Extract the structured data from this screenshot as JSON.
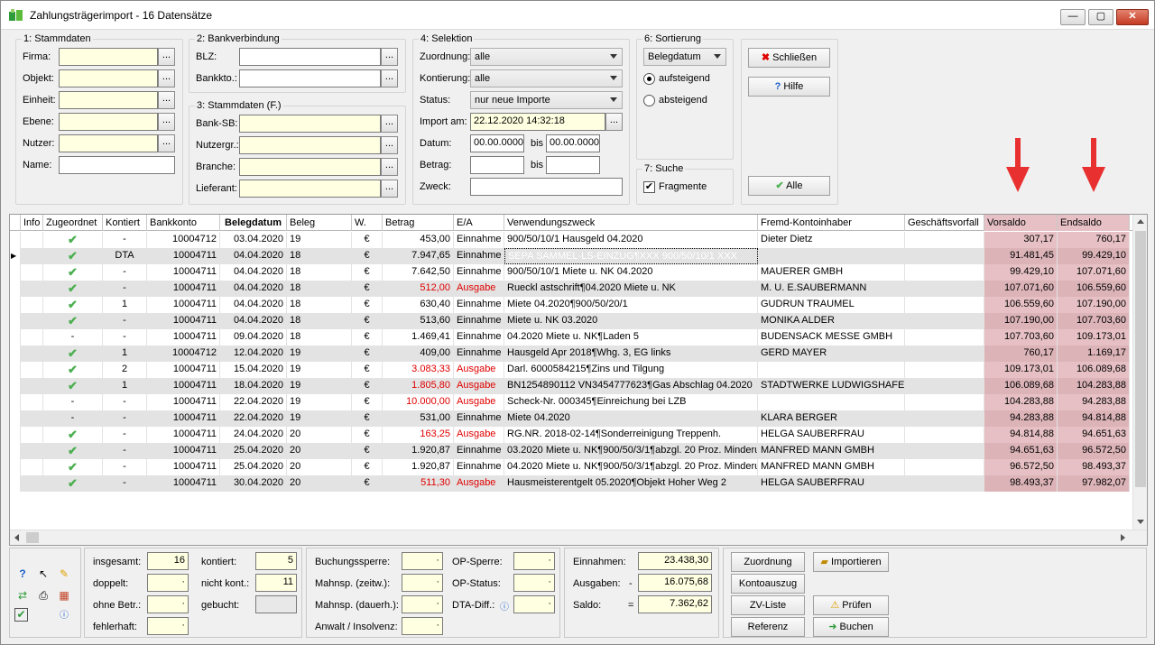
{
  "window": {
    "title": "Zahlungsträgerimport - 16 Datensätze",
    "min": "—",
    "max": "▢",
    "close": "✕"
  },
  "stamm": {
    "title": "1: Stammdaten",
    "fields": [
      {
        "label": "Firma:",
        "value": ""
      },
      {
        "label": "Objekt:",
        "value": ""
      },
      {
        "label": "Einheit:",
        "value": ""
      },
      {
        "label": "Ebene:",
        "value": ""
      },
      {
        "label": "Nutzer:",
        "value": ""
      },
      {
        "label": "Name:",
        "value": ""
      }
    ]
  },
  "bank": {
    "title": "2: Bankverbindung",
    "fields": [
      {
        "label": "BLZ:",
        "value": ""
      },
      {
        "label": "Bankkto.:",
        "value": ""
      }
    ]
  },
  "stammf": {
    "title": "3: Stammdaten (F.)",
    "fields": [
      {
        "label": "Bank-SB:",
        "value": ""
      },
      {
        "label": "Nutzergr.:",
        "value": ""
      },
      {
        "label": "Branche:",
        "value": ""
      },
      {
        "label": "Lieferant:",
        "value": ""
      }
    ]
  },
  "selektion": {
    "title": "4: Selektion",
    "zuordnung_label": "Zuordnung:",
    "zuordnung": "alle",
    "kontierung_label": "Kontierung:",
    "kontierung": "alle",
    "status_label": "Status:",
    "status": "nur neue Importe",
    "import_label": "Import am:",
    "import_value": "22.12.2020 14:32:18",
    "datum_label": "Datum:",
    "datum_from": "00.00.0000",
    "bis": "bis",
    "datum_to": "00.00.0000",
    "betrag_label": "Betrag:",
    "zweck_label": "Zweck:"
  },
  "sort": {
    "title": "6: Sortierung",
    "field": "Belegdatum",
    "asc": "aufsteigend",
    "desc": "absteigend"
  },
  "suche": {
    "title": "7: Suche",
    "fragmente": "Fragmente"
  },
  "buttons": {
    "schliessen": "Schließen",
    "hilfe": "Hilfe",
    "alle": "Alle"
  },
  "columns": [
    "",
    "Info",
    "Zugeordnet",
    "Kontiert",
    "Bankkonto",
    "Belegdatum",
    "Beleg",
    "W.",
    "Betrag",
    "E/A",
    "Verwendungszweck",
    "Fremd-Kontoinhaber",
    "Geschäftsvorfall",
    "Vorsaldo",
    "Endsaldo"
  ],
  "rows": [
    {
      "zug": "✔",
      "kont": "-",
      "konto": "10004712",
      "datum": "03.04.2020",
      "beleg": "19",
      "w": "€",
      "betrag": "453,00",
      "ea": "Einnahme",
      "zweck": "900/50/10/1 Hausgeld 04.2020",
      "fremd": "Dieter Dietz",
      "gv": "",
      "vor": "307,17",
      "end": "760,17"
    },
    {
      "zug": "✔",
      "kont": "DTA",
      "konto": "10004711",
      "datum": "04.04.2020",
      "beleg": "18",
      "w": "€",
      "betrag": "7.947,65",
      "ea": "Einnahme",
      "zweck": "SEPA SAMMEL-LS-EINZUG¶XXX 900/50/10/1 XXX",
      "fremd": "",
      "gv": "",
      "vor": "91.481,45",
      "end": "99.429,10"
    },
    {
      "zug": "✔",
      "kont": "-",
      "konto": "10004711",
      "datum": "04.04.2020",
      "beleg": "18",
      "w": "€",
      "betrag": "7.642,50",
      "ea": "Einnahme",
      "zweck": "900/50/10/1 Miete u. NK 04.2020",
      "fremd": "MAUERER GMBH",
      "gv": "",
      "vor": "99.429,10",
      "end": "107.071,60"
    },
    {
      "zug": "✔",
      "kont": "-",
      "konto": "10004711",
      "datum": "04.04.2020",
      "beleg": "18",
      "w": "€",
      "betrag": "512,00",
      "ea": "Ausgabe",
      "zweck": "Rueckl astschrift¶04.2020 Miete u. NK",
      "fremd": "M. U. E.SAUBERMANN",
      "gv": "",
      "vor": "107.071,60",
      "end": "106.559,60"
    },
    {
      "zug": "✔",
      "kont": "1",
      "konto": "10004711",
      "datum": "04.04.2020",
      "beleg": "18",
      "w": "€",
      "betrag": "630,40",
      "ea": "Einnahme",
      "zweck": "Miete 04.2020¶900/50/20/1",
      "fremd": "GUDRUN TRAUMEL",
      "gv": "",
      "vor": "106.559,60",
      "end": "107.190,00"
    },
    {
      "zug": "✔",
      "kont": "-",
      "konto": "10004711",
      "datum": "04.04.2020",
      "beleg": "18",
      "w": "€",
      "betrag": "513,60",
      "ea": "Einnahme",
      "zweck": "Miete u. NK 03.2020",
      "fremd": "MONIKA ALDER",
      "gv": "",
      "vor": "107.190,00",
      "end": "107.703,60"
    },
    {
      "zug": "-",
      "kont": "-",
      "konto": "10004711",
      "datum": "09.04.2020",
      "beleg": "18",
      "w": "€",
      "betrag": "1.469,41",
      "ea": "Einnahme",
      "zweck": "04.2020 Miete u. NK¶Laden 5",
      "fremd": "BUDENSACK MESSE GMBH",
      "gv": "",
      "vor": "107.703,60",
      "end": "109.173,01"
    },
    {
      "zug": "✔",
      "kont": "1",
      "konto": "10004712",
      "datum": "12.04.2020",
      "beleg": "19",
      "w": "€",
      "betrag": "409,00",
      "ea": "Einnahme",
      "zweck": "Hausgeld Apr 2018¶Whg. 3, EG links",
      "fremd": "GERD MAYER",
      "gv": "",
      "vor": "760,17",
      "end": "1.169,17"
    },
    {
      "zug": "✔",
      "kont": "2",
      "konto": "10004711",
      "datum": "15.04.2020",
      "beleg": "19",
      "w": "€",
      "betrag": "3.083,33",
      "ea": "Ausgabe",
      "zweck": "Darl. 6000584215¶Zins und Tilgung",
      "fremd": "",
      "gv": "",
      "vor": "109.173,01",
      "end": "106.089,68"
    },
    {
      "zug": "✔",
      "kont": "1",
      "konto": "10004711",
      "datum": "18.04.2020",
      "beleg": "19",
      "w": "€",
      "betrag": "1.805,80",
      "ea": "Ausgabe",
      "zweck": "BN1254890112 VN3454777623¶Gas Abschlag 04.2020",
      "fremd": "STADTWERKE LUDWIGSHAFE",
      "gv": "",
      "vor": "106.089,68",
      "end": "104.283,88"
    },
    {
      "zug": "-",
      "kont": "-",
      "konto": "10004711",
      "datum": "22.04.2020",
      "beleg": "19",
      "w": "€",
      "betrag": "10.000,00",
      "ea": "Ausgabe",
      "zweck": "Scheck-Nr. 000345¶Einreichung bei LZB",
      "fremd": "",
      "gv": "",
      "vor": "104.283,88",
      "end": "94.283,88"
    },
    {
      "zug": "-",
      "kont": "-",
      "konto": "10004711",
      "datum": "22.04.2020",
      "beleg": "19",
      "w": "€",
      "betrag": "531,00",
      "ea": "Einnahme",
      "zweck": "Miete 04.2020",
      "fremd": "KLARA BERGER",
      "gv": "",
      "vor": "94.283,88",
      "end": "94.814,88"
    },
    {
      "zug": "✔",
      "kont": "-",
      "konto": "10004711",
      "datum": "24.04.2020",
      "beleg": "20",
      "w": "€",
      "betrag": "163,25",
      "ea": "Ausgabe",
      "zweck": "RG.NR. 2018-02-14¶Sonderreinigung Treppenh.",
      "fremd": "HELGA SAUBERFRAU",
      "gv": "",
      "vor": "94.814,88",
      "end": "94.651,63"
    },
    {
      "zug": "✔",
      "kont": "-",
      "konto": "10004711",
      "datum": "25.04.2020",
      "beleg": "20",
      "w": "€",
      "betrag": "1.920,87",
      "ea": "Einnahme",
      "zweck": "03.2020 Miete u. NK¶900/50/3/1¶abzgl. 20 Proz. Minderu",
      "fremd": "MANFRED MANN GMBH",
      "gv": "",
      "vor": "94.651,63",
      "end": "96.572,50"
    },
    {
      "zug": "✔",
      "kont": "-",
      "konto": "10004711",
      "datum": "25.04.2020",
      "beleg": "20",
      "w": "€",
      "betrag": "1.920,87",
      "ea": "Einnahme",
      "zweck": "04.2020 Miete u. NK¶900/50/3/1¶abzgl. 20 Proz. Minderu",
      "fremd": "MANFRED MANN GMBH",
      "gv": "",
      "vor": "96.572,50",
      "end": "98.493,37"
    },
    {
      "zug": "✔",
      "kont": "-",
      "konto": "10004711",
      "datum": "30.04.2020",
      "beleg": "20",
      "w": "€",
      "betrag": "511,30",
      "ea": "Ausgabe",
      "zweck": "Hausmeisterentgelt 05.2020¶Objekt Hoher Weg 2",
      "fremd": "HELGA SAUBERFRAU",
      "gv": "",
      "vor": "98.493,37",
      "end": "97.982,07"
    }
  ],
  "stats": {
    "insgesamt_label": "insgesamt:",
    "insgesamt": "16",
    "doppelt_label": "doppelt:",
    "doppelt": "",
    "ohne_label": "ohne Betr.:",
    "ohne": "",
    "fehler_label": "fehlerhaft:",
    "fehler": "",
    "kontiert_label": "kontiert:",
    "kontiert": "5",
    "nicht_label": "nicht kont.:",
    "nicht": "11",
    "gebucht_label": "gebucht:",
    "gebucht": ""
  },
  "sperren": {
    "buchung": "Buchungssperre:",
    "mahn_z": "Mahnsp. (zeitw.):",
    "mahn_d": "Mahnsp. (dauerh.):",
    "anwalt": "Anwalt / Insolvenz:",
    "op_sperre": "OP-Sperre:",
    "op_status": "OP-Status:",
    "dta": "DTA-Diff.:"
  },
  "summe": {
    "ein_label": "Einnahmen:",
    "ein": "23.438,30",
    "aus_label": "Ausgaben:",
    "aus_sign": "-",
    "aus": "16.075,68",
    "saldo_label": "Saldo:",
    "saldo_sign": "=",
    "saldo": "7.362,62"
  },
  "actions": {
    "zuordnung": "Zuordnung",
    "importieren": "Importieren",
    "kontoauszug": "Kontoauszug",
    "zvliste": "ZV-Liste",
    "pruefen": "Prüfen",
    "referenz": "Referenz",
    "buchen": "Buchen"
  },
  "colors": {
    "selection": "#0078d7",
    "pink": "#e6c0c4",
    "red": "#e00000",
    "arrow": "#e83030"
  }
}
